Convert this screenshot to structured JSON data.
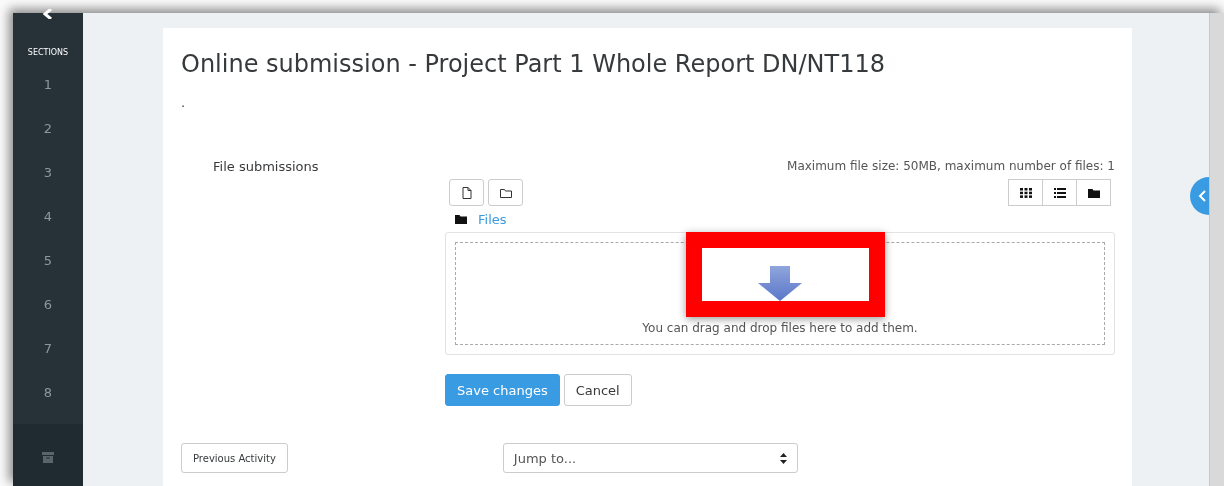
{
  "sidebar": {
    "heading": "SECTIONS",
    "sections": [
      "1",
      "2",
      "3",
      "4",
      "5",
      "6",
      "7",
      "8"
    ]
  },
  "page": {
    "title": "Online submission - Project Part 1 Whole Report DN/NT118",
    "description": ".",
    "field_label": "File submissions",
    "limits": "Maximum file size: 50MB, maximum number of files: 1",
    "file_tools": [
      {
        "kind": "file"
      },
      {
        "kind": "folder"
      }
    ],
    "view_buttons": [
      {
        "kind": "grid"
      },
      {
        "kind": "list"
      },
      {
        "kind": "tree"
      }
    ],
    "path": "Files",
    "drop_hint": "You can drag and drop files here to add them.",
    "buttons": [
      {
        "label": "Save changes",
        "kind": "primary"
      },
      {
        "label": "Cancel",
        "kind": "secondary"
      }
    ],
    "previous_activity": "Previous Activity",
    "jump_select": {
      "value": "Jump to..."
    }
  }
}
